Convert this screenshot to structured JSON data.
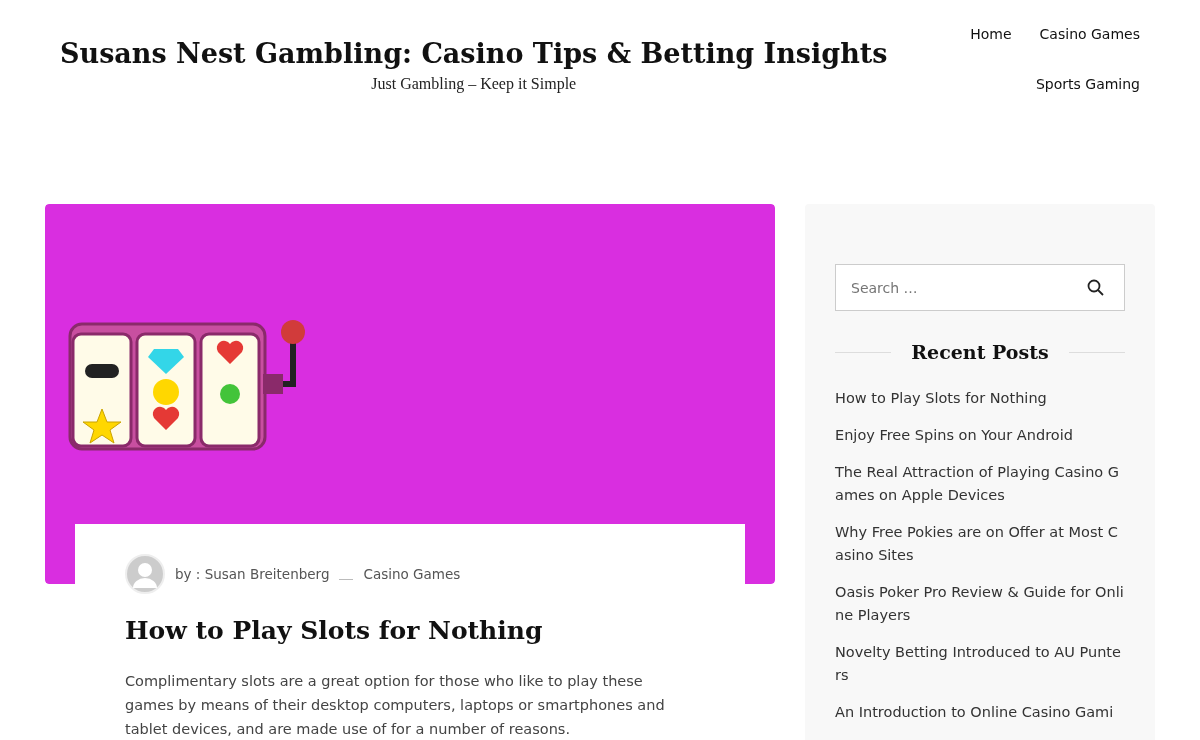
{
  "site": {
    "title": "Susans Nest Gambling: Casino Tips & Betting Insights",
    "tagline": "Just Gambling – Keep it Simple"
  },
  "nav": [
    {
      "label": "Home"
    },
    {
      "label": "Casino Games"
    },
    {
      "label": "Sports Gaming"
    }
  ],
  "post": {
    "author": "by : Susan Breitenberg",
    "category": "Casino Games",
    "title": "How to Play Slots for Nothing",
    "excerpt": "Complimentary slots are a great option for those who like to play these games by means of their desktop computers, laptops or smartphones and tablet devices, and are made use of for a number of reasons."
  },
  "sidebar": {
    "search": {
      "placeholder": "Search …"
    },
    "heading": "Recent Posts",
    "recent_posts": [
      "How to Play Slots for Nothing",
      "Enjoy Free Spins on Your Android",
      "The Real Attraction of Playing Casino Games on Apple Devices",
      "Why Free Pokies are on Offer at Most Casino Sites",
      "Oasis Poker Pro Review & Guide for Online Players",
      "Novelty Betting Introduced to AU Punters",
      "An Introduction to Online Casino Gami"
    ]
  }
}
